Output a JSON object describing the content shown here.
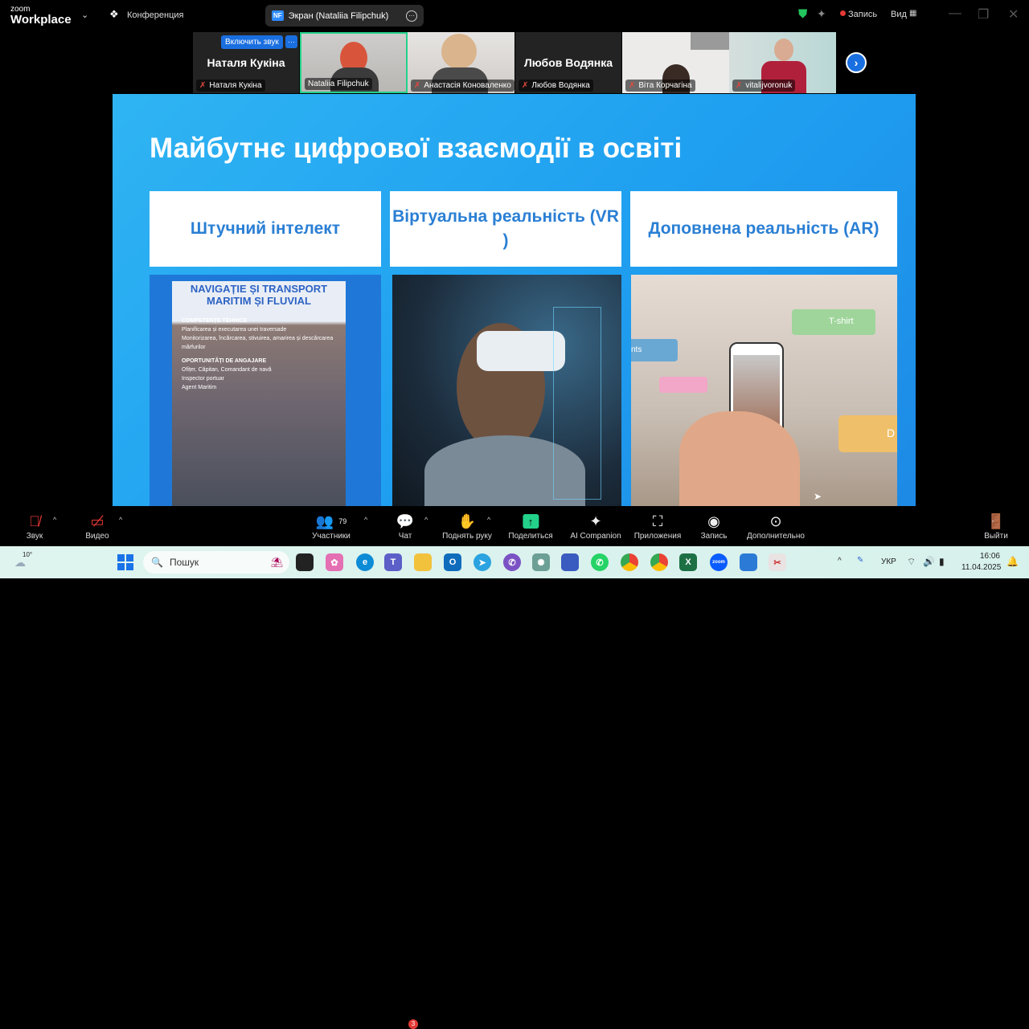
{
  "topbar": {
    "logo_small": "zoom",
    "logo_big": "Workplace",
    "meeting_label": "Конференция",
    "screen_share": {
      "initials": "NF",
      "label": "Экран (Nataliia Filipchuk)"
    },
    "record_label": "Запись",
    "view_label": "Вид"
  },
  "participants": [
    {
      "name": "Наталя Кукіна",
      "big_name": "Наталя Кукіна",
      "unmute_label": "Включить звук",
      "more": "···",
      "video": false
    },
    {
      "name": "Nataliia Filipchuk",
      "video": true,
      "active": true
    },
    {
      "name": "Анастасія Коноваленко",
      "video": true
    },
    {
      "name": "Любов Водянка",
      "big_name": "Любов Водянка",
      "video": false
    },
    {
      "name": "Віта Корчагіна",
      "video": true
    },
    {
      "name": "vitalijvoronuk",
      "video": true
    }
  ],
  "slide": {
    "title": "Майбутнє цифрової взаємодії в освіті",
    "cards": [
      "Штучний інтелект",
      "Віртуальна реальність (VR )",
      "Доповнена реальність (AR)"
    ],
    "poster": {
      "title": "NAVIGAȚIE ȘI TRANSPORT MARITIM ȘI FLUVIAL",
      "section1": "COMPETENȚE TEHNICE",
      "items1": [
        "Planificarea și executarea unei traversade",
        "Monitorizarea, încărcarea, stivuirea, amarirea și descărcarea mărfurilor"
      ],
      "section2": "OPORTUNITĂȚI DE ANGAJARE",
      "items2": [
        "Ofițer, Căpitan, Comandant de navă",
        "Inspector portuar",
        "Agent Maritim"
      ]
    },
    "ar_tags": [
      "T-shirt",
      "nts",
      "D"
    ]
  },
  "toolbar": {
    "audio": "Звук",
    "video": "Видео",
    "participants": "Участники",
    "participants_count": "79",
    "chat": "Чат",
    "chat_badge": "3",
    "raise_hand": "Поднять руку",
    "share": "Поделиться",
    "ai": "AI Companion",
    "apps": "Приложения",
    "record": "Запись",
    "more": "Дополнительно",
    "leave": "Выйти"
  },
  "taskbar": {
    "weather": "10°",
    "search_placeholder": "Пошук",
    "lang": "УКР",
    "time": "16:06",
    "date": "11.04.2025"
  }
}
